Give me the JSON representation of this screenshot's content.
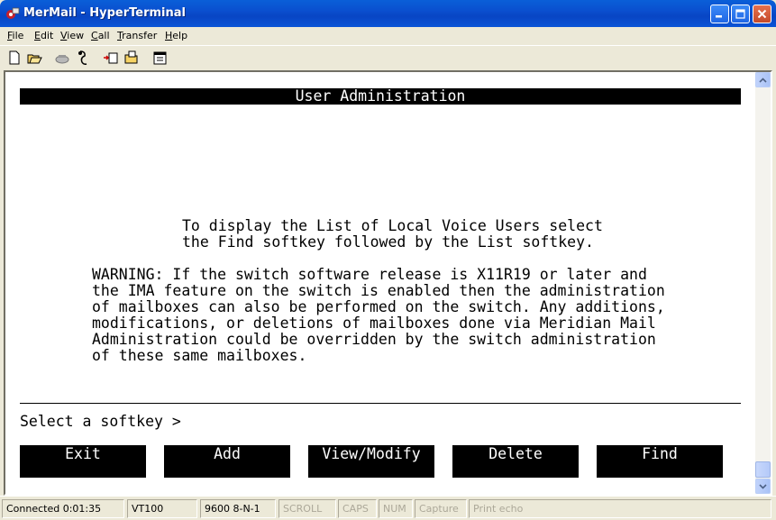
{
  "window": {
    "title": "MerMail - HyperTerminal",
    "controls": [
      "minimize-icon",
      "maximize-icon",
      "close-icon"
    ]
  },
  "menu": [
    "File",
    "Edit",
    "View",
    "Call",
    "Transfer",
    "Help"
  ],
  "toolbar": {
    "tools": [
      "new-icon",
      "open-icon",
      "connect-icon",
      "disconnect-icon",
      "send-icon",
      "receive-icon",
      "properties-icon"
    ]
  },
  "terminal": {
    "header": "User Administration",
    "instructions": [
      "To display the List of Local Voice Users select",
      "the Find softkey followed by the List softkey."
    ],
    "warning": [
      "WARNING: If the switch software release is X11R19 or later and",
      "the IMA feature on the switch is enabled then the administration",
      "of mailboxes can also be performed on the switch. Any additions,",
      "modifications, or deletions of mailboxes done via Meridian Mail",
      "Administration could be overridden by the switch administration",
      "of these same mailboxes."
    ],
    "prompt": "Select a softkey >",
    "softkeys": [
      "Exit",
      "Add",
      "View/Modify",
      "Delete",
      "Find"
    ]
  },
  "status": {
    "connected": "Connected 0:01:35",
    "emulation": "VT100",
    "settings": "9600 8-N-1",
    "scroll": "SCROLL",
    "caps": "CAPS",
    "num": "NUM",
    "capture": "Capture",
    "print_echo": "Print echo"
  }
}
